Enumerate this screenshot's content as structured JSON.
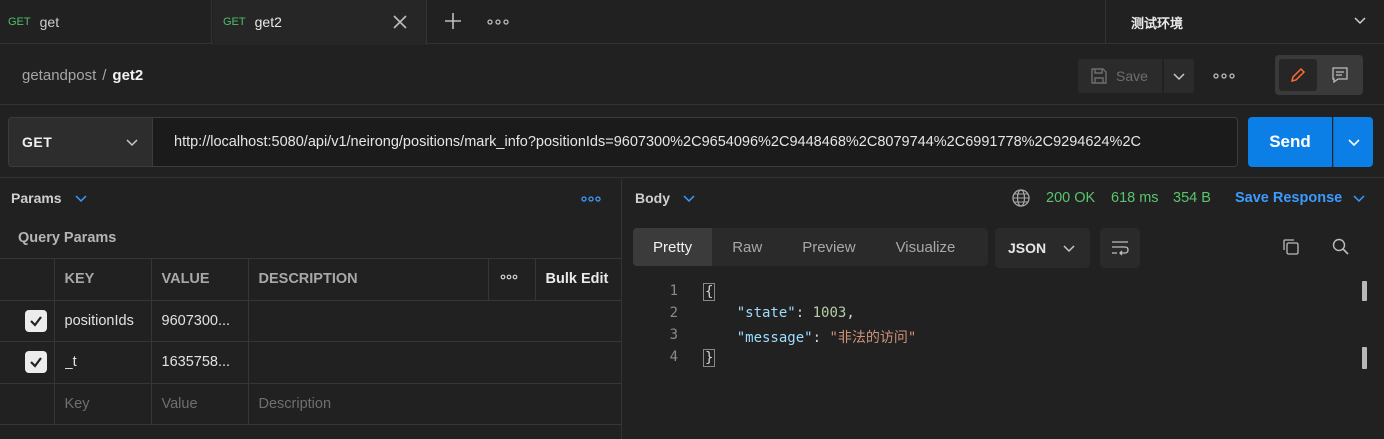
{
  "tabs": [
    {
      "method": "GET",
      "title": "get"
    },
    {
      "method": "GET",
      "title": "get2"
    }
  ],
  "environment": {
    "label": "测试环境"
  },
  "breadcrumb": {
    "collection": "getandpost",
    "separator": "/",
    "request": "get2"
  },
  "toolbar": {
    "save_label": "Save"
  },
  "request": {
    "method": "GET",
    "url": "http://localhost:5080/api/v1/neirong/positions/mark_info?positionIds=9607300%2C9654096%2C9448468%2C8079744%2C6991778%2C9294624%2C",
    "send_label": "Send"
  },
  "params": {
    "tab_label": "Params",
    "section_title": "Query Params",
    "headers": {
      "key": "KEY",
      "value": "VALUE",
      "description": "DESCRIPTION",
      "bulk_edit": "Bulk Edit"
    },
    "rows": [
      {
        "checked": true,
        "key": "positionIds",
        "value": "9607300...",
        "description": ""
      },
      {
        "checked": true,
        "key": "_t",
        "value": "1635758...",
        "description": ""
      }
    ],
    "placeholder": {
      "key": "Key",
      "value": "Value",
      "description": "Description"
    }
  },
  "response": {
    "tab_label": "Body",
    "status": "200 OK",
    "time": "618 ms",
    "size": "354 B",
    "save_response_label": "Save Response",
    "view_tabs": [
      "Pretty",
      "Raw",
      "Preview",
      "Visualize"
    ],
    "active_view": "Pretty",
    "format": "JSON",
    "lines": {
      "n1": "1",
      "n2": "2",
      "n3": "3",
      "n4": "4",
      "open": "{",
      "close": "}",
      "state_key": "\"state\"",
      "state_val": "1003",
      "message_key": "\"message\"",
      "message_val": "\"非法的访问\""
    }
  },
  "colors": {
    "accent": "#0b7fe6",
    "success": "#5ac46d",
    "link": "#3c9bff"
  }
}
